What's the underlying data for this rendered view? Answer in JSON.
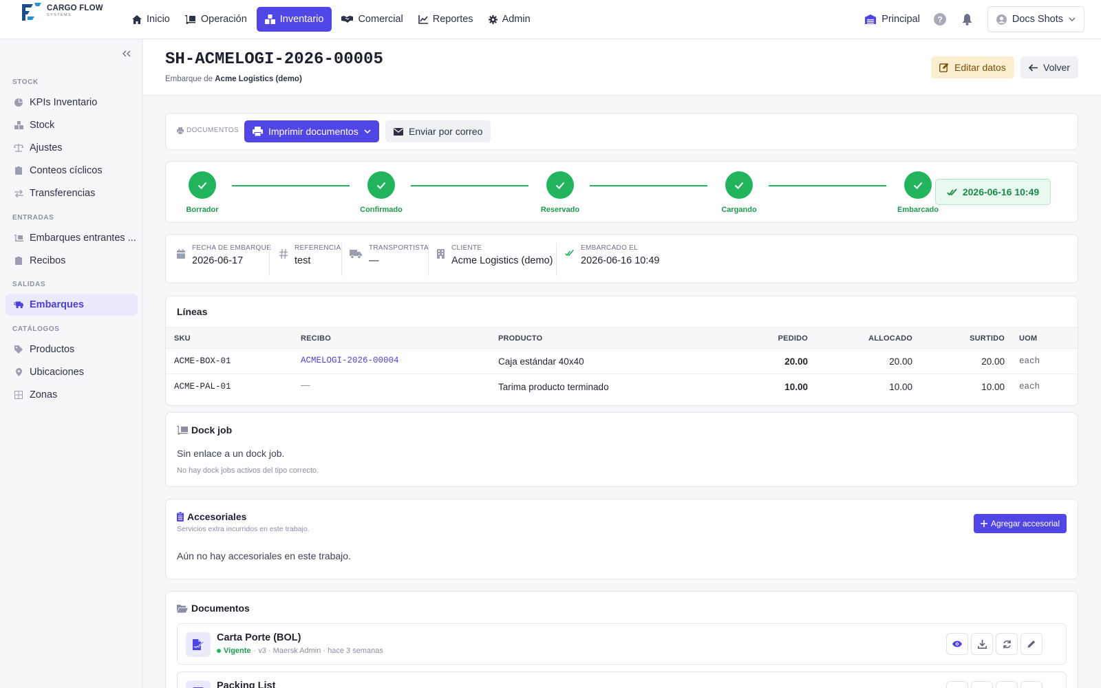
{
  "brand": {
    "line1": "CARGO FLOW",
    "line2": "SYSTEMS"
  },
  "nav": {
    "items": [
      {
        "label": "Inicio",
        "icon": "home-icon"
      },
      {
        "label": "Operación",
        "icon": "dolly-icon"
      },
      {
        "label": "Inventario",
        "icon": "boxes-icon",
        "active": true
      },
      {
        "label": "Comercial",
        "icon": "handshake-icon"
      },
      {
        "label": "Reportes",
        "icon": "chart-line-icon"
      },
      {
        "label": "Admin",
        "icon": "gear-icon"
      }
    ],
    "warehouse": "Principal",
    "user": "Docs Shots"
  },
  "sidebar": {
    "sections": [
      {
        "title": "STOCK",
        "items": [
          "KPIs Inventario",
          "Stock",
          "Ajustes",
          "Conteos cíclicos",
          "Transferencias"
        ]
      },
      {
        "title": "ENTRADAS",
        "items": [
          "Embarques entrantes ...",
          "Recibos"
        ]
      },
      {
        "title": "SALIDAS",
        "items": [
          "Embarques"
        ]
      },
      {
        "title": "CATÁLOGOS",
        "items": [
          "Productos",
          "Ubicaciones",
          "Zonas"
        ]
      }
    ],
    "active": "Embarques"
  },
  "header": {
    "title": "SH-ACMELOGI-2026-00005",
    "subtitle_prefix": "Embarque de",
    "subtitle_client": "Acme Logistics (demo)",
    "edit_label": "Editar datos",
    "back_label": "Volver"
  },
  "docs_bar": {
    "label": "DOCUMENTOS",
    "print_label": "Imprimir documentos",
    "mail_label": "Enviar por correo"
  },
  "stepper": {
    "steps": [
      "Borrador",
      "Confirmado",
      "Reservado",
      "Cargando",
      "Embarcado"
    ],
    "completed": 5,
    "timestamp": "2026-06-16 10:49"
  },
  "info": {
    "fields": [
      {
        "label": "FECHA DE EMBARQUE",
        "value": "2026-06-17",
        "icon": "calendar-icon"
      },
      {
        "label": "REFERENCIA",
        "value": "test",
        "icon": "hash-icon"
      },
      {
        "label": "TRANSPORTISTA",
        "value": "—",
        "icon": "truck-icon"
      },
      {
        "label": "CLIENTE",
        "value": "Acme Logistics (demo)",
        "icon": "building-icon"
      },
      {
        "label": "EMBARCADO EL",
        "value": "2026-06-16 10:49",
        "icon": "double-check-icon"
      }
    ]
  },
  "lines": {
    "title": "Líneas",
    "columns": [
      "SKU",
      "RECIBO",
      "PRODUCTO",
      "PEDIDO",
      "ALLOCADO",
      "SURTIDO",
      "UOM"
    ],
    "rows": [
      {
        "sku": "ACME-BOX-01",
        "recibo": "ACMELOGI-2026-00004",
        "producto": "Caja estándar 40x40",
        "pedido": "20.00",
        "allocado": "20.00",
        "surtido": "20.00",
        "uom": "each"
      },
      {
        "sku": "ACME-PAL-01",
        "recibo": "—",
        "producto": "Tarima producto terminado",
        "pedido": "10.00",
        "allocado": "10.00",
        "surtido": "10.00",
        "uom": "each"
      }
    ]
  },
  "dock_job": {
    "title": "Dock job",
    "text": "Sin enlace a un dock job.",
    "note": "No hay dock jobs activos del tipo correcto."
  },
  "accesoriales": {
    "title": "Accesoriales",
    "subtitle": "Servicios extra incurridos en este trabajo.",
    "add_label": "Agregar accesorial",
    "empty": "Aún no hay accesoriales en este trabajo."
  },
  "documentos": {
    "title": "Documentos",
    "items": [
      {
        "name": "Carta Porte (BOL)",
        "status": "Vigente",
        "meta": "· v3 · Maersk Admin · hace 3 semanas"
      },
      {
        "name": "Packing List",
        "status": "",
        "meta": ""
      }
    ]
  },
  "colors": {
    "accent": "#5046e5",
    "success": "#22b45c",
    "edit_bg": "#fdeecf"
  }
}
